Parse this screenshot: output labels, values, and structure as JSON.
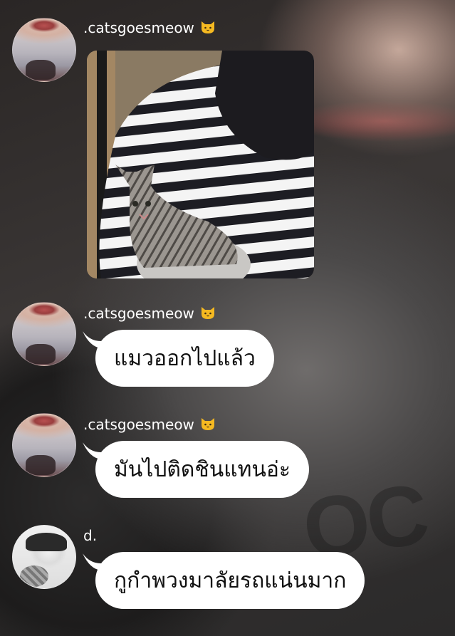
{
  "messages": [
    {
      "username": ".catsgoesmeow",
      "has_cat_badge": true,
      "type": "image",
      "image_desc": "photo"
    },
    {
      "username": ".catsgoesmeow",
      "has_cat_badge": true,
      "type": "text",
      "text": "แมวออกไปแล้ว"
    },
    {
      "username": ".catsgoesmeow",
      "has_cat_badge": true,
      "type": "text",
      "text": "มันไปติดชินแทนอ่ะ"
    },
    {
      "username": "d.",
      "has_cat_badge": false,
      "type": "text",
      "text": "กูกำพวงมาลัยรถแน่นมาก"
    }
  ],
  "colors": {
    "bubble": "#ffffff",
    "username": "#ffffff",
    "badge": "#f5b921"
  },
  "icons": {
    "badge": "cat-face-icon",
    "avatar_1": "avatar-catsgoesmeow",
    "avatar_2": "avatar-d"
  }
}
